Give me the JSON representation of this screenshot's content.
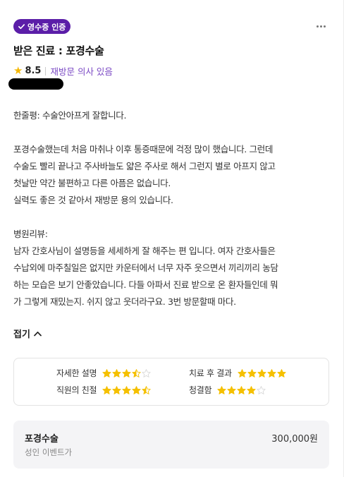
{
  "badge": {
    "label": "영수증 인증",
    "icon": "check-icon",
    "color": "#5b1ea8"
  },
  "more_icon": "more-horizontal-icon",
  "title": "받은 진료 :  포경수술",
  "rating": {
    "score": "8.5",
    "revisit": "재방문 의사 있음",
    "icon": "star-icon"
  },
  "review": {
    "summary": "한줄평: 수술안아프게 잘합니다.",
    "paragraph1": "포경수술했는데 처음 마취나 이후 통증때문에 걱정 많이 했습니다. 그런데\n수술도 빨리 끝나고 주사바늘도 얇은 주사로 해서 그런지 별로 아프지 않고\n첫날만 약간 불편하고 다른 아픔은 없습니다.\n실력도 좋은 것 같아서 재방문 용의 있습니다.",
    "hospital_heading": "병원리뷰:",
    "paragraph2": "남자 간호사님이 설명등을 세세하게 잘 해주는 편 입니다. 여자 간호사들은\n수납외에 마주칠일은 없지만 카운터에서 너무 자주 웃으면서 끼리끼리 농담\n하는 모습은 보기 안좋았습니다. 다들 아파서 진료 받으로 온 환자들인데 뭐\n가 그렇게 재밌는지. 쉬지 않고 웃더라구요. 3번 방문할때 마다."
  },
  "fold_label": "접기",
  "detail_ratings": [
    {
      "label": "자세한 설명",
      "stars": 3.5
    },
    {
      "label": "치료 후 결과",
      "stars": 5
    },
    {
      "label": "직원의 친절",
      "stars": 4.5
    },
    {
      "label": "청결함",
      "stars": 4
    }
  ],
  "star_color": "#f5c000",
  "price": {
    "name": "포경수술",
    "sub": "성인 이벤트가",
    "amount": "300,000원"
  }
}
